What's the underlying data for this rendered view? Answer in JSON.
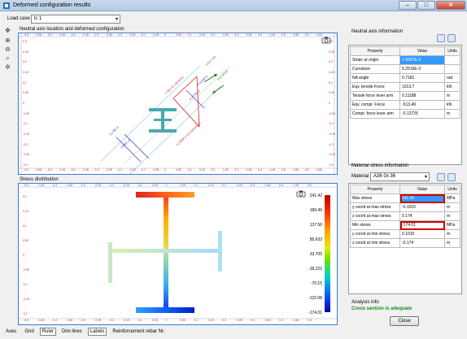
{
  "window": {
    "title": "Deformed configuration results"
  },
  "load_case": {
    "label": "Load case",
    "value": "lc 1"
  },
  "top_plot": {
    "title": "Neutral axis location and deformed configuration"
  },
  "bottom_plot": {
    "title": "Stress distribution"
  },
  "ruler_h_top": [
    "-0.6",
    "-0.55",
    "-0.5",
    "-0.45",
    "-0.4",
    "-0.35",
    "-0.3",
    "-0.25",
    "-0.2",
    "-0.15",
    "-0.1",
    "-0.05",
    "0",
    "0.05",
    "0.1",
    "0.15",
    "0.2",
    "0.25",
    "0.3",
    "0.35",
    "0.4",
    "0.45",
    "0.5",
    "0.55",
    "0.6",
    "0.65"
  ],
  "ruler_v_top": [
    "0.3",
    "0.25",
    "0.2",
    "0.15",
    "0.1",
    "0.05",
    "0",
    "-0.05",
    "-0.1",
    "-0.15",
    "-0.2",
    "-0.25",
    "-0.3"
  ],
  "ruler_h_bot": [
    "-0.5",
    "-0.45",
    "-0.4",
    "-0.35",
    "-0.3",
    "-0.25",
    "-0.2",
    "-0.15",
    "-0.1",
    "-0.05",
    "0",
    "0.05",
    "0.1",
    "0.15",
    "0.2",
    "0.25",
    "0.3",
    "0.35",
    "0.4",
    "0.45",
    "0.5"
  ],
  "ruler_v_bot": [
    "0.2",
    "0.15",
    "0.1",
    "0.05",
    "0",
    "-0.05",
    "-0.1",
    "-0.15",
    "-0.2"
  ],
  "annotations": {
    "tension": "1.35E+01 (Tension)",
    "compression": "-5.7606E-4 (Compression)",
    "f1": "1013.7 kN",
    "f2": "-513.49 kN",
    "d1": "0.11188 m",
    "d2": "0.12725 m",
    "l1": "0.1785 m",
    "l2": "0.0857 m"
  },
  "colorbar": {
    "labels": [
      "241.42",
      "189.49",
      "137.56",
      "85.633",
      "33.705",
      "-18.222",
      "-70.15",
      "-122.08",
      "-174.01"
    ]
  },
  "neutral_axis": {
    "title": "Neutral axis information",
    "headers": [
      "Property",
      "Value",
      "Units"
    ],
    "rows": [
      [
        "Strain at origin",
        "1.6857E-4",
        ""
      ],
      [
        "Curvature",
        "5.2515E-3",
        ""
      ],
      [
        "NA angle",
        "0.7181",
        "rad"
      ],
      [
        "Eqv. tensile Force",
        "1013.7",
        "kN"
      ],
      [
        "Tensile force lever arm",
        "0.11188",
        "m"
      ],
      [
        "Eqv. compr. Force",
        "-513.49",
        "kN"
      ],
      [
        "Compr. force lever arm",
        "-0.12725",
        "m"
      ]
    ]
  },
  "material_stress": {
    "title": "Material stress information",
    "material_label": "Material",
    "material_value": "A36 Gr.36",
    "headers": [
      "Property",
      "Value",
      "Units"
    ],
    "rows": [
      [
        "Max stress",
        "241.42",
        "MPa"
      ],
      [
        "y coord at max stress",
        "-0.1015",
        "m"
      ],
      [
        "z coord at max stress",
        "0.174",
        "m"
      ],
      [
        "Min stress",
        "-174.01",
        "MPa"
      ],
      [
        "y coord at min stress",
        "0.1015",
        "m"
      ],
      [
        "z coord at min stress",
        "-0.174",
        "m"
      ]
    ]
  },
  "analysis": {
    "title": "Analysis info",
    "message": "Cross section is adequate",
    "message_color": "#1a8a1a"
  },
  "close_label": "Close",
  "bottom_tabs": [
    "Axes",
    "Grid",
    "Ruler",
    "Dim lines",
    "Labels",
    "Reinforcement rebar Nr."
  ]
}
